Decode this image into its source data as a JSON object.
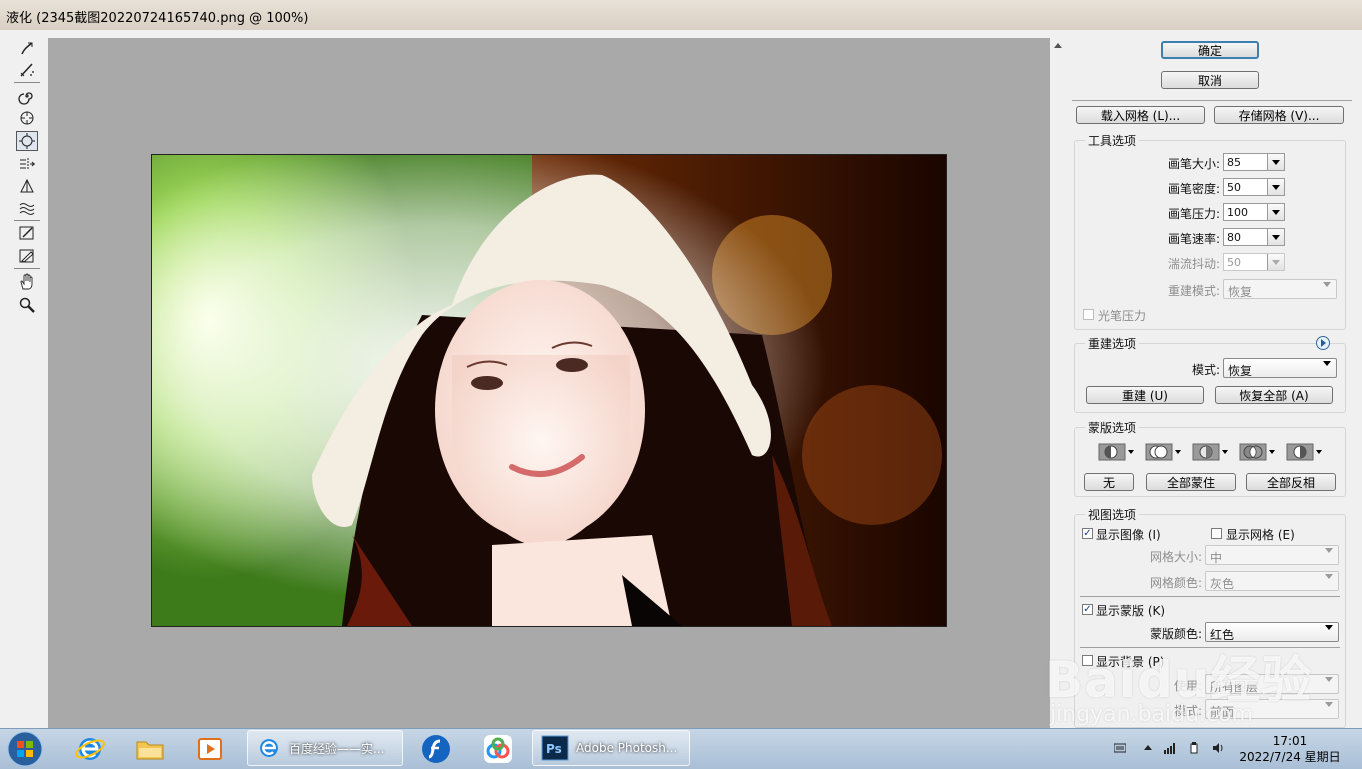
{
  "window": {
    "title": "液化 (2345截图20220724165740.png @ 100%)"
  },
  "toolbox": {
    "tools": [
      "forward-warp-tool-icon",
      "reconstruct-tool-icon",
      "twirl-clockwise-tool-icon",
      "pucker-tool-icon",
      "bloat-tool-icon",
      "push-left-tool-icon",
      "mirror-tool-icon",
      "turbulence-tool-icon",
      "freeze-mask-tool-icon",
      "thaw-mask-tool-icon",
      "hand-tool-icon",
      "zoom-tool-icon"
    ],
    "selected": "bloat-tool-icon"
  },
  "buttons": {
    "ok": "确定",
    "cancel": "取消",
    "load_mesh": "载入网格 (L)...",
    "save_mesh": "存储网格 (V)..."
  },
  "tool_options": {
    "title": "工具选项",
    "brush_size_label": "画笔大小:",
    "brush_size": "85",
    "brush_density_label": "画笔密度:",
    "brush_density": "50",
    "brush_pressure_label": "画笔压力:",
    "brush_pressure": "100",
    "brush_rate_label": "画笔速率:",
    "brush_rate": "80",
    "turbulent_jitter_label": "湍流抖动:",
    "turbulent_jitter": "50",
    "reconstruct_mode_label": "重建模式:",
    "reconstruct_mode": "恢复",
    "stylus_pressure_label": "光笔压力"
  },
  "reconstruct_options": {
    "title": "重建选项",
    "mode_label": "模式:",
    "mode": "恢复",
    "reconstruct_button": "重建 (U)",
    "restore_all_button": "恢复全部 (A)"
  },
  "mask_options": {
    "title": "蒙版选项",
    "none_button": "无",
    "mask_all_button": "全部蒙住",
    "invert_all_button": "全部反相"
  },
  "view_options": {
    "title": "视图选项",
    "show_image_label": "显示图像 (I)",
    "show_image": true,
    "show_mesh_label": "显示网格 (E)",
    "show_mesh": false,
    "mesh_size_label": "网格大小:",
    "mesh_size": "中",
    "mesh_color_label": "网格颜色:",
    "mesh_color": "灰色",
    "show_mask_label": "显示蒙版 (K)",
    "show_mask": true,
    "mask_color_label": "蒙版颜色:",
    "mask_color": "红色",
    "show_backdrop_label": "显示背景 (P)",
    "show_backdrop": false,
    "use_label": "使用:",
    "use": "所有图层",
    "mode_label": "模式:",
    "mode": "前面"
  },
  "watermark": {
    "brand": "Baidu经验",
    "url": "jingyan.baidu.com"
  },
  "taskbar": {
    "tasks": [
      {
        "label": "百度经验——实...",
        "icon": "ie-icon"
      },
      {
        "label": "Adobe Photosh...",
        "icon": "photoshop-icon"
      }
    ],
    "photoshop_badge": "Ps",
    "clock_time": "17:01",
    "clock_date": "2022/7/24 星期日"
  },
  "colors": {
    "accent_blue": "#3c7fb1",
    "preview_bg": "#a9a9a9",
    "taskbar": "#b5c8dc"
  }
}
